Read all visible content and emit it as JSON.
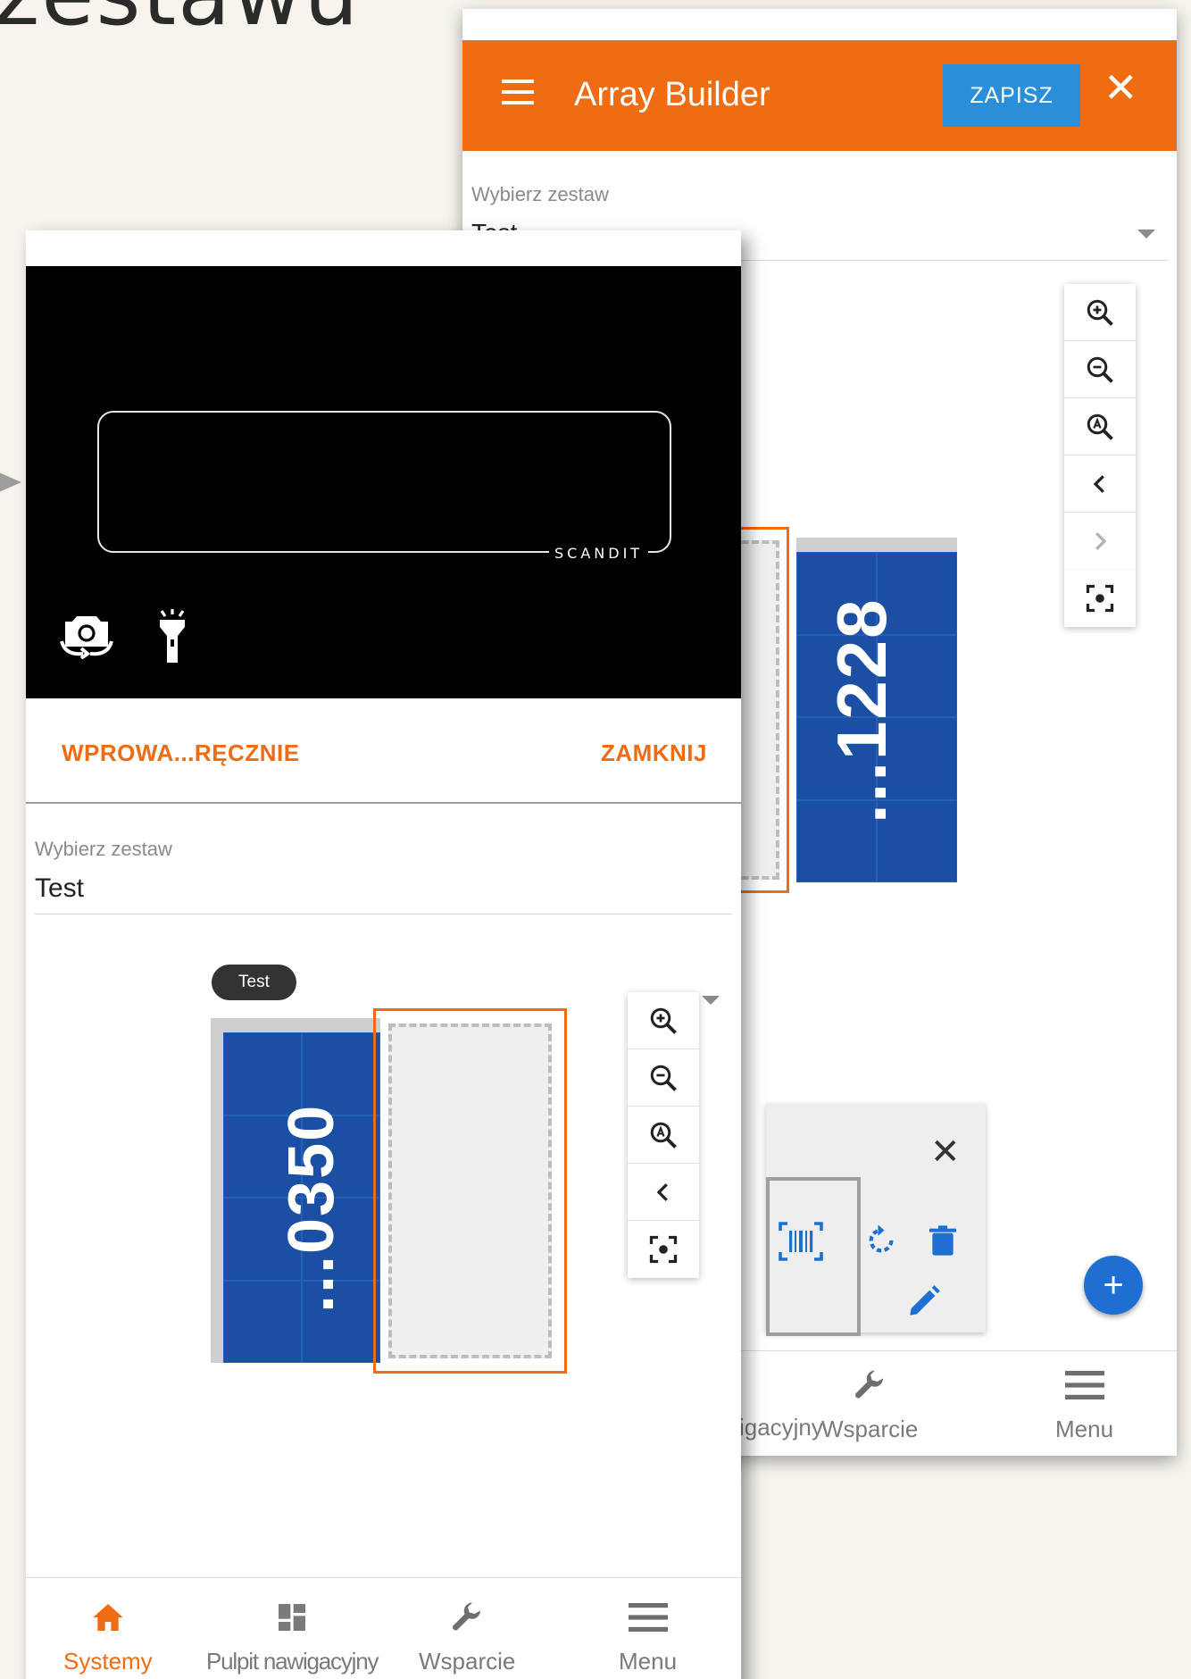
{
  "background": {
    "title_fragment": "zestawu"
  },
  "back_screen": {
    "app_title": "Array Builder",
    "save_label": "ZAPISZ",
    "select_label": "Wybierz zestaw",
    "select_value": "Test",
    "panel_number": "...1228",
    "zoom_controls": [
      "zoom-in",
      "zoom-out",
      "zoom-auto",
      "previous",
      "next",
      "center-focus"
    ],
    "nav": [
      {
        "label": "Pulpit nawigacyjny"
      },
      {
        "label": "Wsparcie"
      },
      {
        "label": "Menu"
      }
    ]
  },
  "front_screen": {
    "scanner_brand": "SCANDIT",
    "manual_entry_label": "WPROWA...RĘCZNIE",
    "close_label": "ZAMKNIJ",
    "select_label": "Wybierz zestaw",
    "select_value": "Test",
    "array_chip": "Test",
    "panel_number": "...0350",
    "zoom_controls": [
      "zoom-in",
      "zoom-out",
      "zoom-auto",
      "previous",
      "center-focus"
    ],
    "nav": [
      {
        "label": "Systemy",
        "active": true
      },
      {
        "label": "Pulpit nawigacyjny",
        "active": false
      },
      {
        "label": "Wsparcie",
        "active": false
      },
      {
        "label": "Menu",
        "active": false
      }
    ]
  },
  "colors": {
    "accent": "#ef6c13",
    "primary_button": "#2a8ed8",
    "panel_blue": "#1b4fa4",
    "fab": "#1e6fd1"
  }
}
